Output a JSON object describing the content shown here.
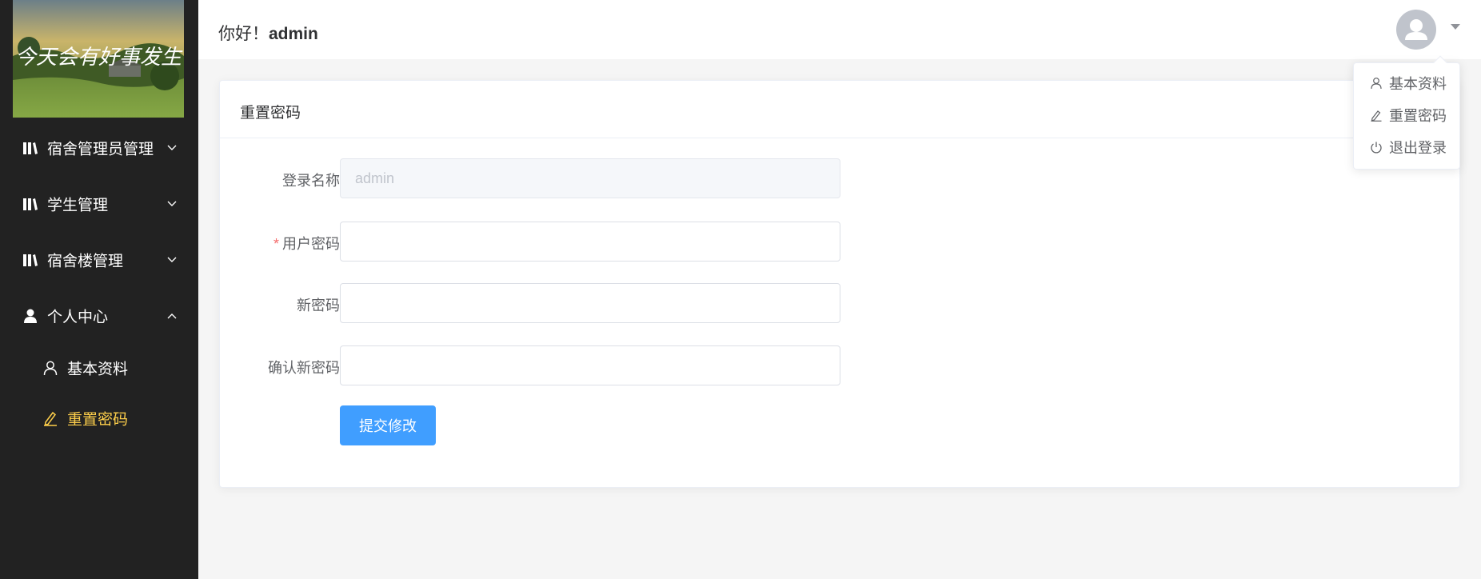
{
  "sidebar": {
    "logo": {
      "text": "今天会有好事发生"
    },
    "menu": [
      {
        "label": "宿舍管理员管理",
        "icon": "book-icon",
        "expanded": false
      },
      {
        "label": "学生管理",
        "icon": "book-icon",
        "expanded": false
      },
      {
        "label": "宿舍楼管理",
        "icon": "book-icon",
        "expanded": false
      },
      {
        "label": "个人中心",
        "icon": "user-filled-icon",
        "expanded": true
      }
    ],
    "submenu": [
      {
        "label": "基本资料",
        "icon": "user-icon",
        "active": false
      },
      {
        "label": "重置密码",
        "icon": "edit-icon",
        "active": true
      }
    ],
    "active_color": "#ffd04b",
    "background": "#222222"
  },
  "header": {
    "greeting_prefix": "你好！",
    "username": "admin"
  },
  "dropdown": {
    "items": [
      {
        "label": "基本资料",
        "icon": "user-icon"
      },
      {
        "label": "重置密码",
        "icon": "edit-icon"
      },
      {
        "label": "退出登录",
        "icon": "power-icon"
      }
    ]
  },
  "card": {
    "title": "重置密码",
    "fields": {
      "login_name": {
        "label": "登录名称",
        "value": "admin",
        "disabled": true
      },
      "user_password": {
        "label": "用户密码",
        "required": true,
        "value": ""
      },
      "new_password": {
        "label": "新密码",
        "value": ""
      },
      "confirm_password": {
        "label": "确认新密码",
        "value": ""
      }
    },
    "required_mark": "*",
    "submit_label": "提交修改"
  },
  "colors": {
    "primary": "#409eff",
    "danger": "#f56c6c"
  }
}
